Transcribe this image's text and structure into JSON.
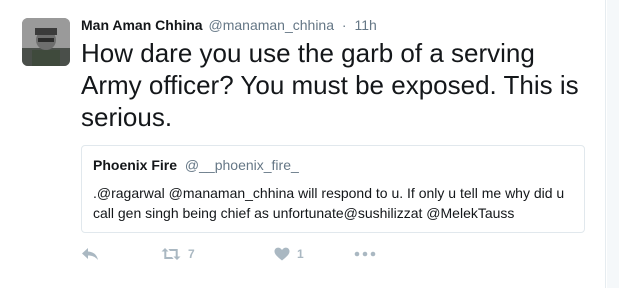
{
  "tweet": {
    "fullname": "Man Aman Chhina",
    "username": "@manaman_chhina",
    "separator": "·",
    "time": "11h",
    "text": "How dare you use the garb of a serving Army officer? You must be exposed. This is serious."
  },
  "quote": {
    "fullname": "Phoenix Fire",
    "username": "@__phoenix_fire_",
    "text": ".@ragarwal @manaman_chhina will respond to u. If only u tell me why did u call gen singh being chief as unfortunate@sushilizzat @MelekTauss"
  },
  "actions": {
    "retweet_count": "7",
    "like_count": "1",
    "icons": [
      "reply-icon",
      "retweet-icon",
      "heart-icon",
      "more-icon"
    ]
  },
  "colors": {
    "text": "#14171a",
    "secondary": "#657786",
    "icon": "#aab8c2",
    "border": "#e1e8ed"
  }
}
